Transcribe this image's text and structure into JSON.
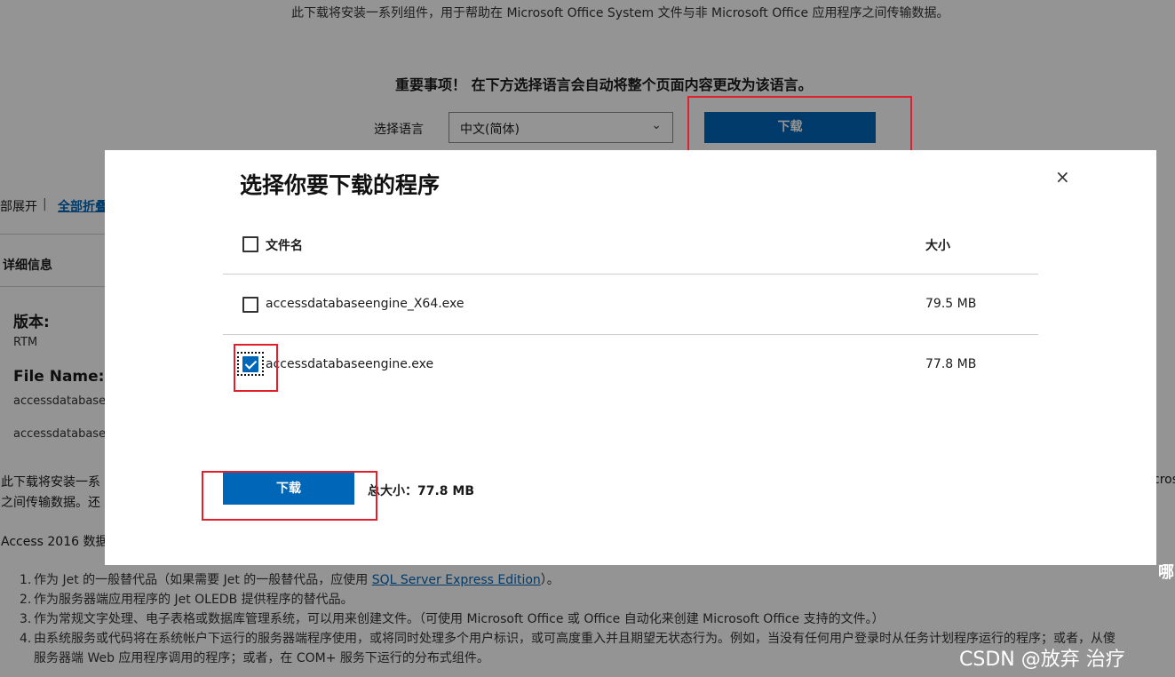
{
  "page": {
    "intro": "此下载将安装一系列组件，用于帮助在 Microsoft Office System 文件与非 Microsoft Office 应用程序之间传输数据。",
    "important_notice": "重要事项！ 在下方选择语言会自动将整个页面内容更改为该语言。",
    "language_label": "选择语言",
    "language_selected": "中文(简体)",
    "download_label": "下载",
    "expand_all": "部展开",
    "separator": "|",
    "collapse_all": "全部折叠",
    "details_heading": "详细信息",
    "version_label": "版本:",
    "version_value": "RTM",
    "filename_label": "File Name:",
    "filename_1": "accessdatabase",
    "filename_2": "accessdatabase",
    "desc_line1": "此下载将安装一系",
    "desc_line2": "之间传输数据。还",
    "desc_right": "cros",
    "access_line": "Access 2016 数据",
    "list": [
      {
        "num": "1.",
        "text_before": "作为 Jet 的一般替代品（如果需要 Jet 的一般替代品，应使用 ",
        "link": "SQL Server Express Edition",
        "text_after": "）。"
      },
      {
        "num": "2.",
        "text_before": "作为服务器端应用程序的 Jet OLEDB 提供程序的替代品。",
        "link": "",
        "text_after": ""
      },
      {
        "num": "3.",
        "text_before": "作为常规文字处理、电子表格或数据库管理系统，可以用来创建文件。（可使用 Microsoft Office 或 Office 自动化来创建 Microsoft Office 支持的文件。）",
        "link": "",
        "text_after": ""
      },
      {
        "num": "4.",
        "text_before": "由系统服务或代码将在系统帐户下运行的服务器端程序使用，或将同时处理多个用户标识，或可高度重入并且期望无状态行为。例如，当没有任何用户登录时从任务计划程序运行的程序；或者，从傻",
        "link": "",
        "text_after": ""
      },
      {
        "num": "",
        "text_before": "服务器端 Web 应用程序调用的程序；或者，在 COM+ 服务下运行的分布式组件。",
        "link": "",
        "text_after": ""
      }
    ],
    "edge_char": "哪",
    "watermark": "CSDN @放弃      治疗"
  },
  "modal": {
    "title": "选择你要下载的程序",
    "close_glyph": "×",
    "header_filename": "文件名",
    "header_size": "大小",
    "files": [
      {
        "name": "accessdatabaseengine_X64.exe",
        "size": "79.5 MB",
        "checked": false
      },
      {
        "name": "accessdatabaseengine.exe",
        "size": "77.8 MB",
        "checked": true
      }
    ],
    "download_label": "下载",
    "total_label": "总大小：",
    "total_value": "77.8 MB"
  },
  "colors": {
    "accent": "#0067b8",
    "highlight_box": "#e0202c",
    "overlay": "rgba(0,0,0,0.42)"
  },
  "icons": [
    "chevron-down-icon",
    "close-icon",
    "checkbox-icon"
  ]
}
